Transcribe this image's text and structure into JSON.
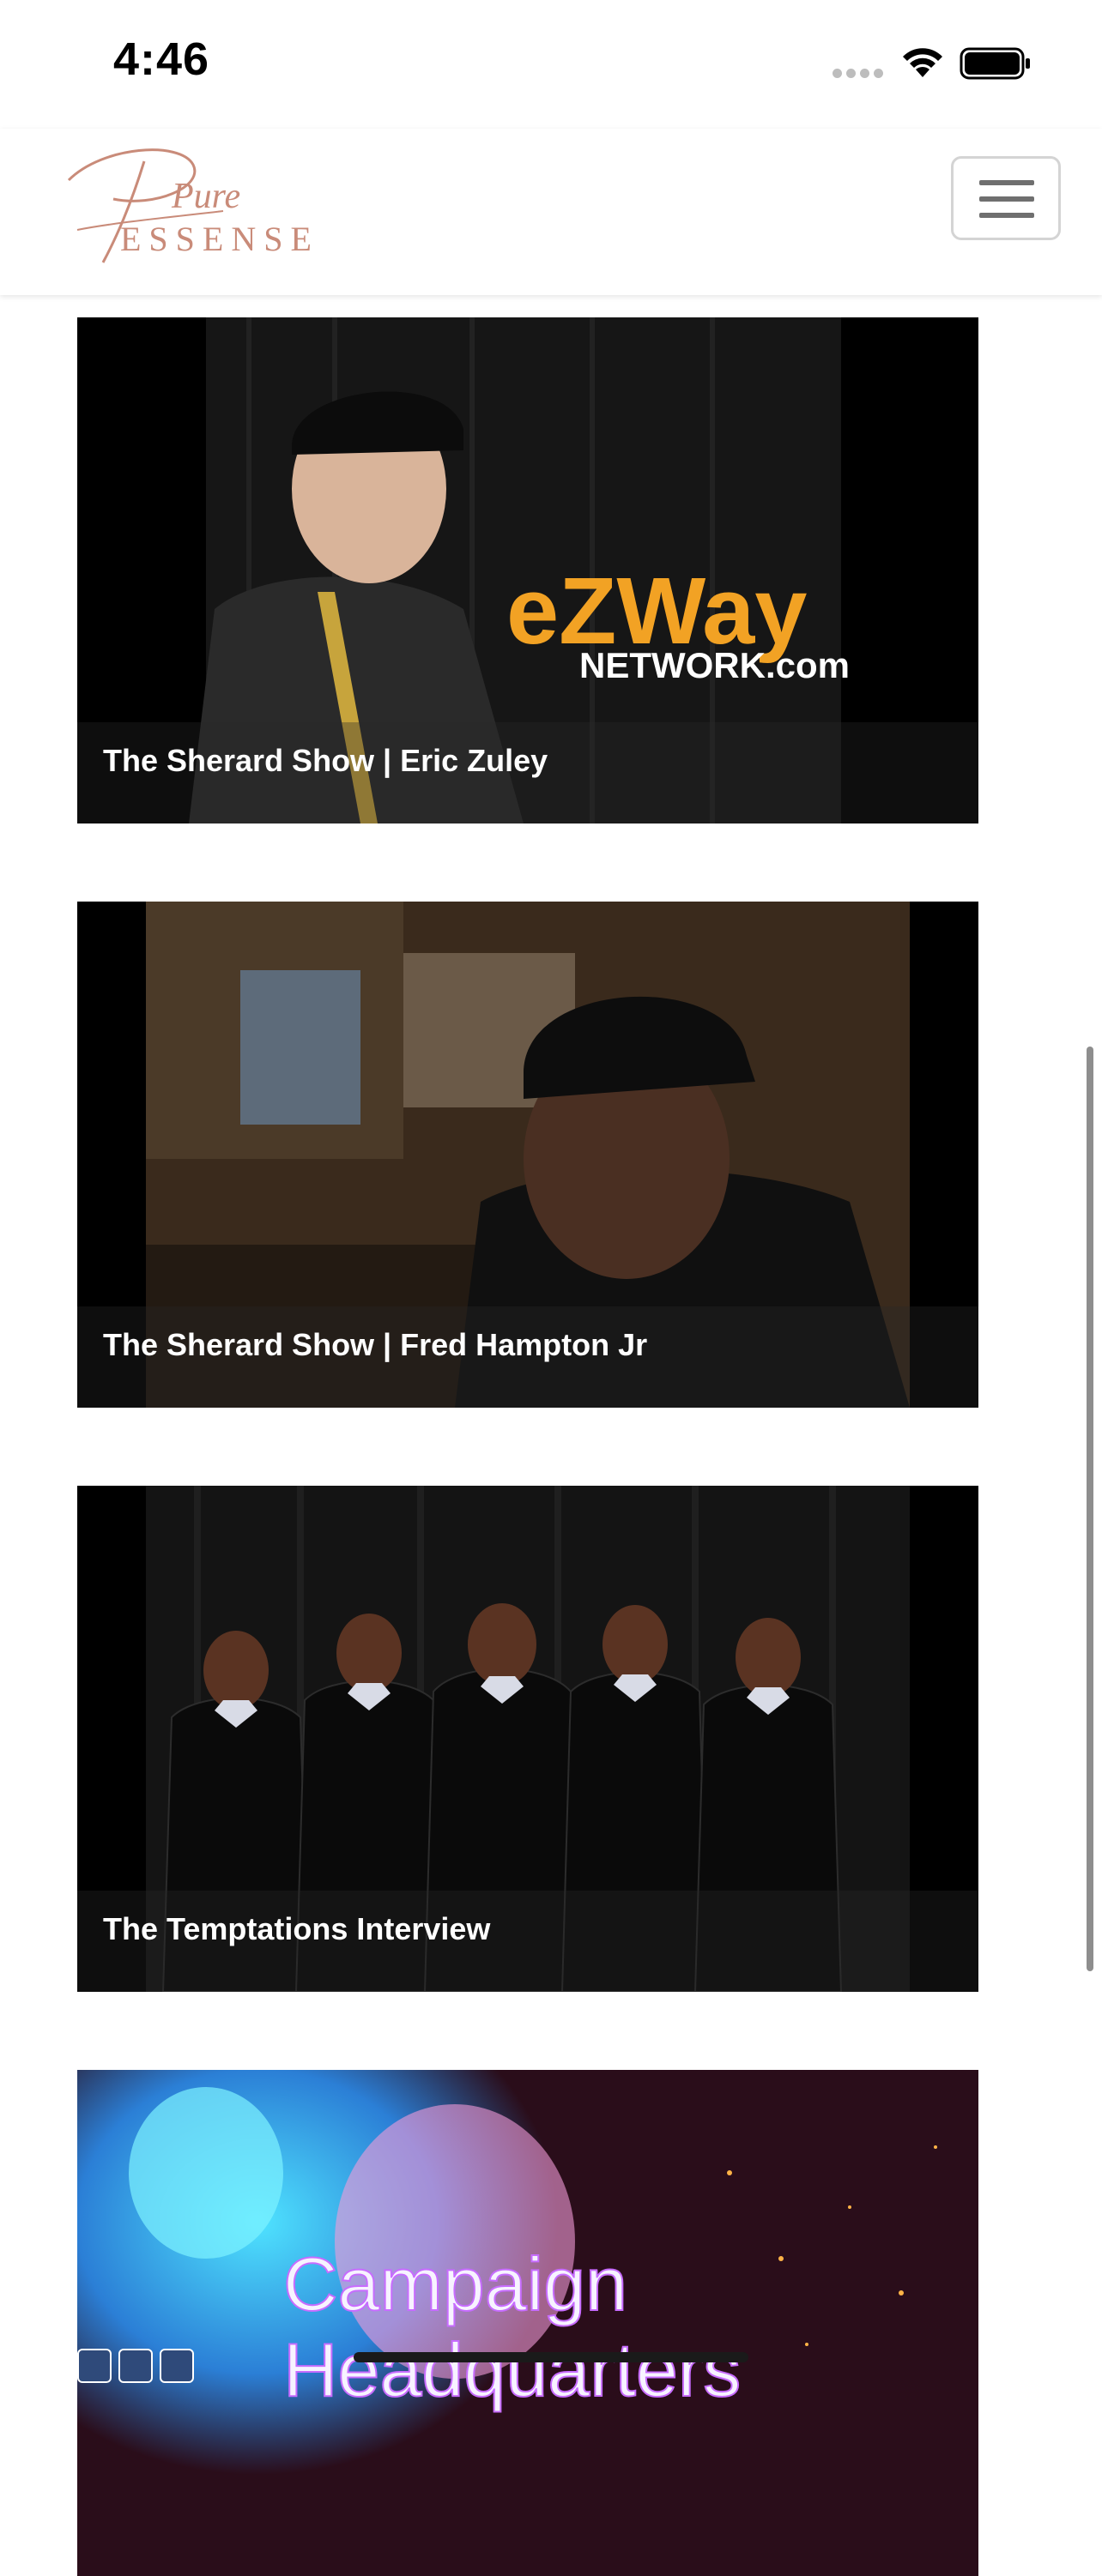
{
  "status_bar": {
    "time": "4:46"
  },
  "header": {
    "logo_script": "Pure",
    "logo_word": "ESSENSE",
    "logo_color": "#c98b79"
  },
  "feed": [
    {
      "title": "The Sherard Show | Eric Zuley",
      "thumb_text_1": "eZWay",
      "thumb_text_2": "NETWORK.com"
    },
    {
      "title": "The Sherard Show | Fred Hampton Jr"
    },
    {
      "title": "The Temptations Interview"
    },
    {
      "title": "",
      "thumb_text_1": "Campaign",
      "thumb_text_2": "Headquarters"
    }
  ]
}
